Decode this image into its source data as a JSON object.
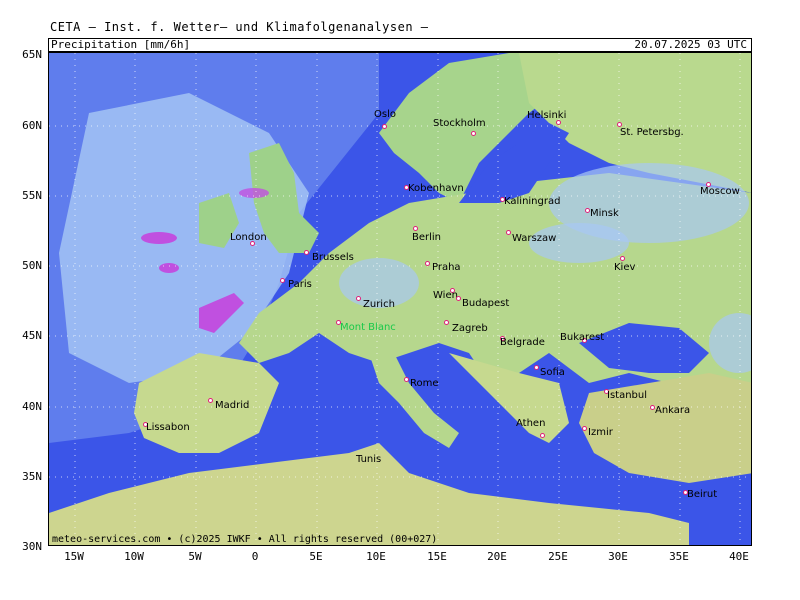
{
  "header": {
    "title": "CETA – Inst. f. Wetter– und Klimafolgenanalysen –"
  },
  "info_bar": {
    "parameter": "Precipitation [mm/6h]",
    "datetime": "20.07.2025 03 UTC"
  },
  "axes": {
    "lat_labels": [
      "65N",
      "60N",
      "55N",
      "50N",
      "45N",
      "40N",
      "35N",
      "30N"
    ],
    "lon_labels": [
      "15W",
      "10W",
      "5W",
      "0",
      "5E",
      "10E",
      "15E",
      "20E",
      "25E",
      "30E",
      "35E",
      "40E"
    ]
  },
  "cities": {
    "oslo": "Oslo",
    "stockholm": "Stockholm",
    "helsinki": "Helsinki",
    "st_petersburg": "St. Petersbg.",
    "kobenhavn": "Kobenhavn",
    "kaliningrad": "Kaliningrad",
    "minsk": "Minsk",
    "moscow": "Moscow",
    "london": "London",
    "brussels": "Brussels",
    "berlin": "Berlin",
    "warszaw": "Warszaw",
    "paris": "Paris",
    "praha": "Praha",
    "kiev": "Kiev",
    "wien": "Wien",
    "budapest": "Budapest",
    "zurich": "Zurich",
    "mont_blanc": "Mont Blanc",
    "zagreb": "Zagreb",
    "bukarest": "Bukarest",
    "belgrade": "Belgrade",
    "sofia": "Sofia",
    "rome": "Rome",
    "istanbul": "Istanbul",
    "madrid": "Madrid",
    "ankara": "Ankara",
    "lissabon": "Lissabon",
    "athen": "Athen",
    "izmir": "Izmir",
    "tunis": "Tunis",
    "beirut": "Beirut"
  },
  "footer": {
    "copyright": "meteo-services.com • (c)2025 IWKF • All rights reserved (00+027)"
  },
  "colors": {
    "sea": "#3b55e8",
    "land_low": "#9ed18a",
    "land_mid": "#c6d98f",
    "precip_light": "#a8c8f4",
    "precip_heavy": "#c050e0"
  }
}
